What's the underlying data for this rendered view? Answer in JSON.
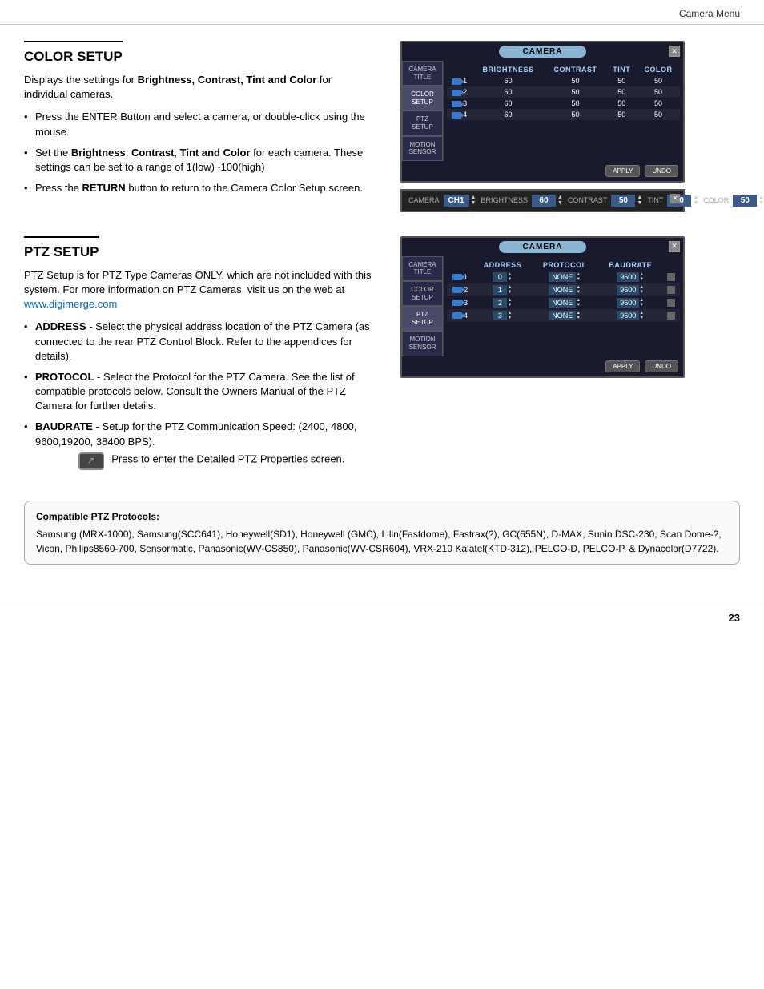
{
  "page": {
    "header": "Camera Menu",
    "footer_page": "23"
  },
  "color_setup": {
    "section_title": "COLOR SETUP",
    "intro": "Displays the settings for ",
    "intro_bold": "Brightness, Contrast, Tint and Color",
    "intro_end": " for individual cameras.",
    "bullets": [
      {
        "text": "Press the ENTER Button and select a camera, or double-click using the mouse."
      },
      {
        "text_parts": [
          {
            "bold": false,
            "text": "Set the "
          },
          {
            "bold": true,
            "text": "Brightness"
          },
          {
            "bold": false,
            "text": ", "
          },
          {
            "bold": true,
            "text": "Contrast"
          },
          {
            "bold": false,
            "text": ", "
          },
          {
            "bold": true,
            "text": "Tint and Color"
          },
          {
            "bold": false,
            "text": " for each camera. These settings can be set to a range of 1(low)~100(high)"
          }
        ]
      },
      {
        "text_parts": [
          {
            "bold": false,
            "text": "Press the "
          },
          {
            "bold": true,
            "text": "RETURN"
          },
          {
            "bold": false,
            "text": " button to return to the Camera Color Setup screen."
          }
        ]
      }
    ],
    "camera_ui": {
      "title": "CAMERA",
      "columns": [
        "",
        "BRIGHTNESS",
        "CONTRAST",
        "TINT",
        "COLOR"
      ],
      "rows": [
        {
          "cam": "1",
          "brightness": "60",
          "contrast": "50",
          "tint": "50",
          "color": "50"
        },
        {
          "cam": "2",
          "brightness": "60",
          "contrast": "50",
          "tint": "50",
          "color": "50"
        },
        {
          "cam": "3",
          "brightness": "60",
          "contrast": "50",
          "tint": "50",
          "color": "50"
        },
        {
          "cam": "4",
          "brightness": "60",
          "contrast": "50",
          "tint": "50",
          "color": "50"
        }
      ],
      "sidebar_items": [
        "CAMERA TITLE",
        "COLOR SETUP",
        "PTZ SETUP",
        "MOTION SENSOR"
      ],
      "apply_label": "APPLY",
      "undo_label": "UNDO"
    },
    "bottom_bar": {
      "fields": [
        {
          "label": "CAMERA",
          "value": "CH1"
        },
        {
          "label": "BRIGHTNESS",
          "value": "60"
        },
        {
          "label": "CONTRAST",
          "value": "50"
        },
        {
          "label": "TINT",
          "value": "50"
        },
        {
          "label": "COLOR",
          "value": "50"
        }
      ]
    }
  },
  "ptz_setup": {
    "section_title": "PTZ SETUP",
    "intro": "PTZ Setup is for PTZ Type Cameras ONLY, which are not included with this system. For more information on PTZ Cameras, visit us on the web at ",
    "link_text": "www.digimerge.com",
    "bullets": [
      {
        "label": "ADDRESS",
        "text": " - Select the physical address location of the PTZ Camera (as connected to the rear PTZ Control Block. Refer to the appendices for details)."
      },
      {
        "label": "PROTOCOL",
        "text": " - Select the Protocol for the PTZ Camera. See the list of compatible protocols below. Consult the Owners Manual of the PTZ Camera for further details."
      },
      {
        "label": "BAUDRATE",
        "text": " - Setup for the PTZ Communication Speed: (2400, 4800, 9600,19200, 38400 BPS).",
        "extra": "Press to enter the Detailed PTZ Properties screen."
      }
    ],
    "camera_ui": {
      "title": "CAMERA",
      "columns": [
        "",
        "ADDRESS",
        "PROTOCOL",
        "BAUDRATE"
      ],
      "rows": [
        {
          "cam": "1",
          "address": "0",
          "protocol": "NONE",
          "baudrate": "9600"
        },
        {
          "cam": "2",
          "address": "1",
          "protocol": "NONE",
          "baudrate": "9600"
        },
        {
          "cam": "3",
          "address": "2",
          "protocol": "NONE",
          "baudrate": "9600"
        },
        {
          "cam": "4",
          "address": "3",
          "protocol": "NONE",
          "baudrate": "9600"
        }
      ],
      "sidebar_items": [
        "CAMERA TITLE",
        "COLOR SETUP",
        "PTZ SETUP",
        "MOTION SENSOR"
      ],
      "apply_label": "APPLY",
      "undo_label": "UNDO"
    }
  },
  "compat_box": {
    "title": "Compatible PTZ Protocols:",
    "text": "Samsung (MRX-1000), Samsung(SCC641), Honeywell(SD1), Honeywell (GMC), Lilin(Fastdome), Fastrax(?), GC(655N), D-MAX, Sunin DSC-230, Scan Dome-?, Vicon, Philips8560-700, Sensormatic, Panasonic(WV-CS850), Panasonic(WV-CSR604), VRX-210 Kalatel(KTD-312), PELCO-D, PELCO-P, & Dynacolor(D7722)."
  }
}
